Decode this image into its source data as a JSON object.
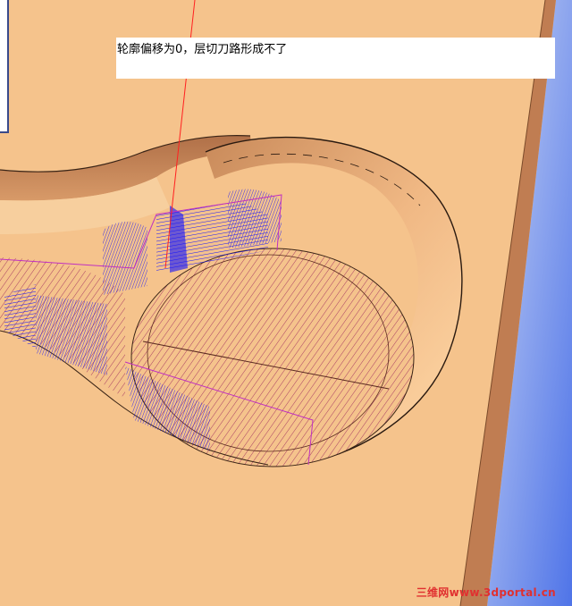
{
  "caption": {
    "text": "轮廓偏移为0，层切刀路形成不了"
  },
  "watermark": {
    "text": "三维网www.3dportal.cn"
  },
  "colors": {
    "part_surface": "#f5c38c",
    "part_shadow": "#b77a4e",
    "part_highlight": "#ffe6c0",
    "toolpath_blue": "#1010ff",
    "toolpath_magenta": "#c030c0",
    "hatch": "#a03060",
    "background_blue": "#6f8fe8",
    "axis_red": "#ff2020"
  }
}
